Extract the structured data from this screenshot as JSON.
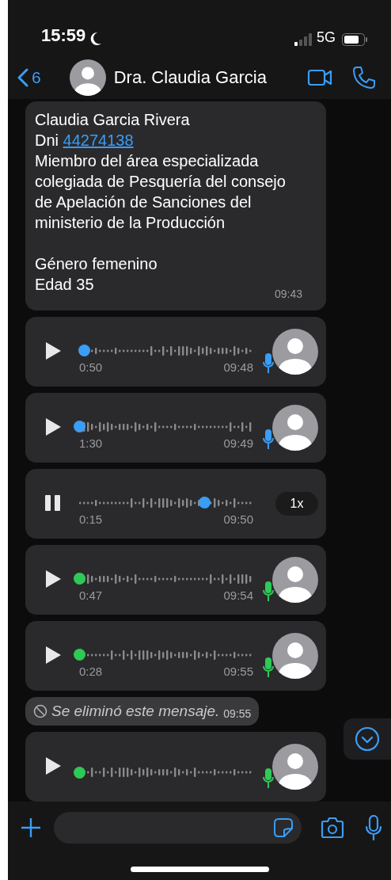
{
  "status_bar": {
    "time": "15:59",
    "network": "5G"
  },
  "header": {
    "back_count": "6",
    "contact_name": "Dra. Claudia Garcia"
  },
  "messages": [
    {
      "kind": "text",
      "time": "09:43",
      "paragraphs": [
        [
          {
            "text": "Claudia Garcia Rivera"
          },
          {
            "text": "Dni",
            "link": "44274138"
          },
          {
            "text": "Miembro del área especializada colegiada de Pesquería del consejo de Apelación de Sanciones del ministerio de la Producción"
          }
        ],
        [
          {
            "text": "Género femenino"
          },
          {
            "text": "Edad 35"
          }
        ]
      ]
    },
    {
      "kind": "voice",
      "playing": false,
      "played": true,
      "level": 0.03,
      "duration": "0:50",
      "time": "09:48"
    },
    {
      "kind": "voice",
      "playing": false,
      "played": true,
      "level": 0.0,
      "duration": "1:30",
      "time": "09:49"
    },
    {
      "kind": "voice",
      "playing": true,
      "played": true,
      "level": 0.72,
      "duration": "0:15",
      "time": "09:50",
      "speed": "1x"
    },
    {
      "kind": "voice",
      "playing": false,
      "played": false,
      "level": 0.0,
      "duration": "0:47",
      "time": "09:54"
    },
    {
      "kind": "voice",
      "playing": false,
      "played": false,
      "level": 0.0,
      "duration": "0:28",
      "time": "09:55"
    },
    {
      "kind": "deleted",
      "text": "Se eliminó este mensaje.",
      "time": "09:55"
    },
    {
      "kind": "voice",
      "playing": false,
      "played": false,
      "level": 0.0
    }
  ]
}
